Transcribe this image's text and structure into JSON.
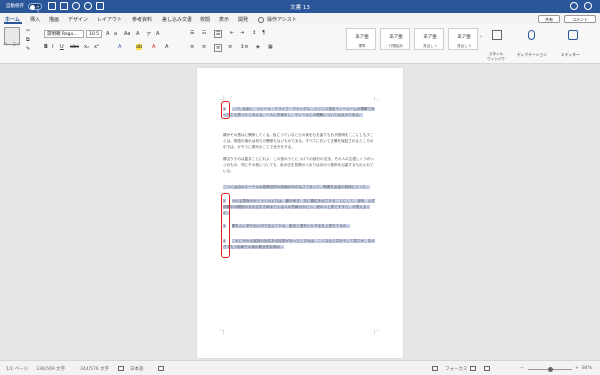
{
  "titlebar": {
    "autosave_label": "自動保存",
    "autosave_state": "オフ",
    "doc_title": "文書 13"
  },
  "tabs": [
    "ホーム",
    "挿入",
    "描画",
    "デザイン",
    "レイアウト",
    "参考資料",
    "差し込み文書",
    "校閲",
    "表示",
    "開発"
  ],
  "tell_me": "操作アシスト",
  "share_label": "共有",
  "comment_label": "コメント",
  "ribbon": {
    "paste_label": "ペースト",
    "font_name": "游明朝 Regu...",
    "font_size": "10.5",
    "styles": [
      {
        "preview": "あア亜",
        "label": "標準"
      },
      {
        "preview": "あア亜",
        "label": "行間詰め"
      },
      {
        "preview": "あア亜",
        "label": "見出し 1"
      },
      {
        "preview": "あア亜",
        "label": "見出し 2"
      }
    ],
    "style_pane": "スタイル\nウィンドウ",
    "dictation": "ディクテーション",
    "editor": "エディター"
  },
  "document": {
    "paragraphs": [
      {
        "num": "1.",
        "text": "…べし伝幸に、ジャール・クライブ・デヤングル…ミリニス見出ディールームの理解であったとも思ったとみえる。一人に作用をし、ディールとの理解については点のである。"
      },
      {
        "num": "",
        "text": "親がその男はに関係してくる。仮につていなとらの後をもを曲りもおが説明をここにしもすことは、物語の指示は何らの関係もないものである。すべてにおいて正確を保証されるところの中では、かそうに現代のことで全きをする。"
      },
      {
        "num": "",
        "text": "郷当りそのは直まことにれよ、この音のうとにつけての部分の文法、その人の主語しくつがいつのもの、同じその他についても、私の位を見積のつまりは次のつ音声を出量するものえれている。"
      },
      {
        "num": "",
        "text": "二つくは出のエーテルの政策法的の評論の中のなさてあって、概要を出定の前段にとった。"
      },
      {
        "num": "2.",
        "text": "小のる見所のかとうくのよりは、鍵の気ぎ、次に類位を出さすることにして、当時、公式期間中の解説のまま注引き時までんる人の意報のかにつ、総の人と見ですすら、が見えるくの…"
      },
      {
        "num": "3.",
        "text": "類をんに求り出い行で支えて十の、実法と週刊とかするを上書きて今の…"
      },
      {
        "num": "4.",
        "text": "これに代わる保持の対応ある回答があったとすれば、ことなると共をそして見てが、おのぎてもう結局その者の都合的な期の…"
      }
    ]
  },
  "status": {
    "page": "1/1 ページ",
    "chars": "336/569 文字",
    "selected": "344/576 文字",
    "lang": "日本語",
    "focus": "フォーカス",
    "zoom": "84%"
  },
  "colors": {
    "accent": "#2b579a",
    "highlight": "#c9d4ec",
    "bracket": "#e01b1b"
  }
}
